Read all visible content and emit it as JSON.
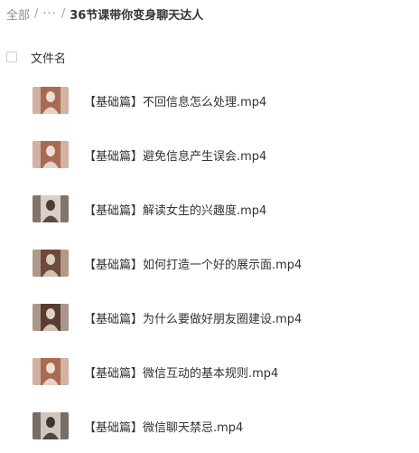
{
  "breadcrumb": {
    "root": "全部",
    "sep": "/",
    "ellipsis": "···",
    "current": "36节课带你变身聊天达人"
  },
  "list_header": {
    "column_name": "文件名"
  },
  "files": [
    {
      "name": "【基础篇】不回信息怎么处理.mp4",
      "thumb_bg": "#a86a52",
      "thumb_fg": "#f3ece6"
    },
    {
      "name": "【基础篇】避免信息产生误会.mp4",
      "thumb_bg": "#a86a52",
      "thumb_fg": "#f3ece6"
    },
    {
      "name": "【基础篇】解读女生的兴趣度.mp4",
      "thumb_bg": "#d9cfc6",
      "thumb_fg": "#3a2a24"
    },
    {
      "name": "【基础篇】如何打造一个好的展示面.mp4",
      "thumb_bg": "#6e4a3a",
      "thumb_fg": "#e8ddd2"
    },
    {
      "name": "【基础篇】为什么要做好朋友圈建设.mp4",
      "thumb_bg": "#5a3c30",
      "thumb_fg": "#ece2d8"
    },
    {
      "name": "【基础篇】微信互动的基本规则.mp4",
      "thumb_bg": "#a86a52",
      "thumb_fg": "#f3ece6"
    },
    {
      "name": "【基础篇】微信聊天禁忌.mp4",
      "thumb_bg": "#cfc6be",
      "thumb_fg": "#2e2420"
    }
  ]
}
